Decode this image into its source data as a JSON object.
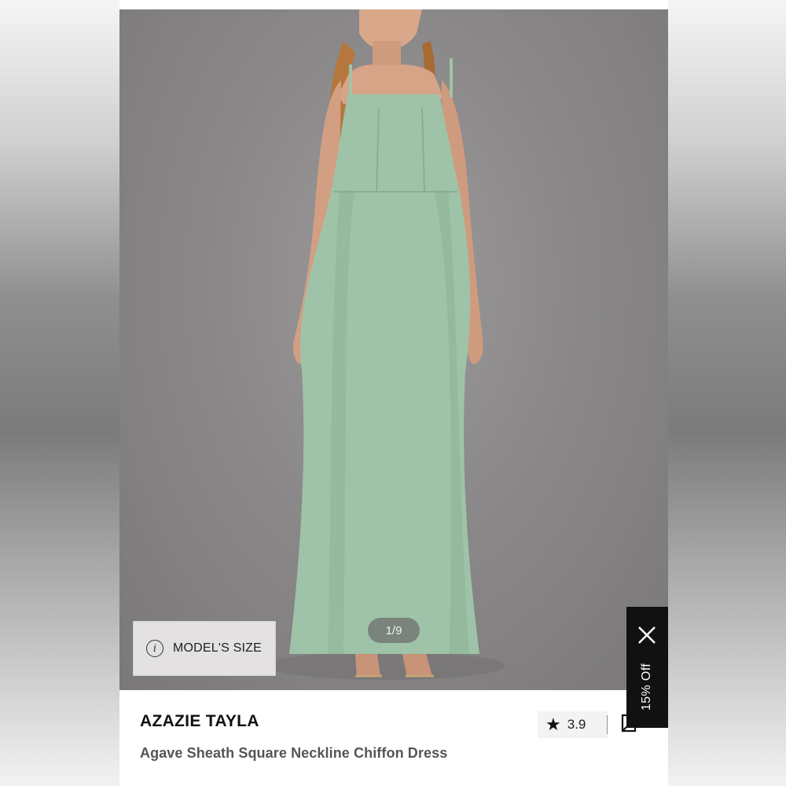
{
  "product": {
    "brand": "AZAZIE TAYLA",
    "name": "Agave Sheath Square Neckline Chiffon Dress",
    "rating": "3.9",
    "dress_color": "#9fc3a8"
  },
  "gallery": {
    "page_indicator": "1/9",
    "model_size_label": "MODEL'S SIZE"
  },
  "promo": {
    "label": "15% Off"
  },
  "icons": {
    "info": "info-icon",
    "star": "star-icon",
    "bookmark": "bookmark-icon",
    "close": "close-icon"
  }
}
